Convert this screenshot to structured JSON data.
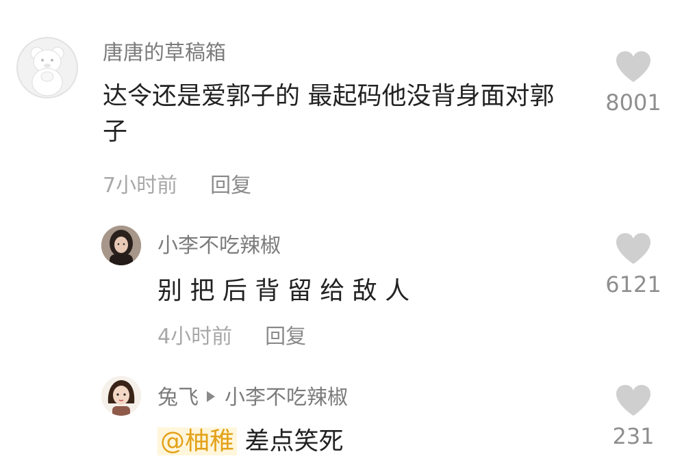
{
  "comments": [
    {
      "username": "唐唐的草稿箱",
      "text": "达令还是爱郭子的 最起码他没背身面对郭子",
      "time": "7小时前",
      "reply_label": "回复",
      "likes": "8001",
      "avatar_icon": "teddy-bear-avatar"
    },
    {
      "username": "小李不吃辣椒",
      "text": "别 把 后 背 留 给 敌 人",
      "time": "4小时前",
      "reply_label": "回复",
      "likes": "6121",
      "avatar_icon": "girl-photo-avatar"
    },
    {
      "username": "兔飞",
      "reply_to": "小李不吃辣椒",
      "mention": "@柚稚",
      "text": "差点笑死",
      "likes": "231",
      "avatar_icon": "cartoon-girl-avatar"
    }
  ],
  "colors": {
    "username": "#7b7b7b",
    "text": "#222222",
    "meta": "#a8a8a8",
    "heart": "#cfcfcf",
    "mention": "#e3a21a"
  }
}
